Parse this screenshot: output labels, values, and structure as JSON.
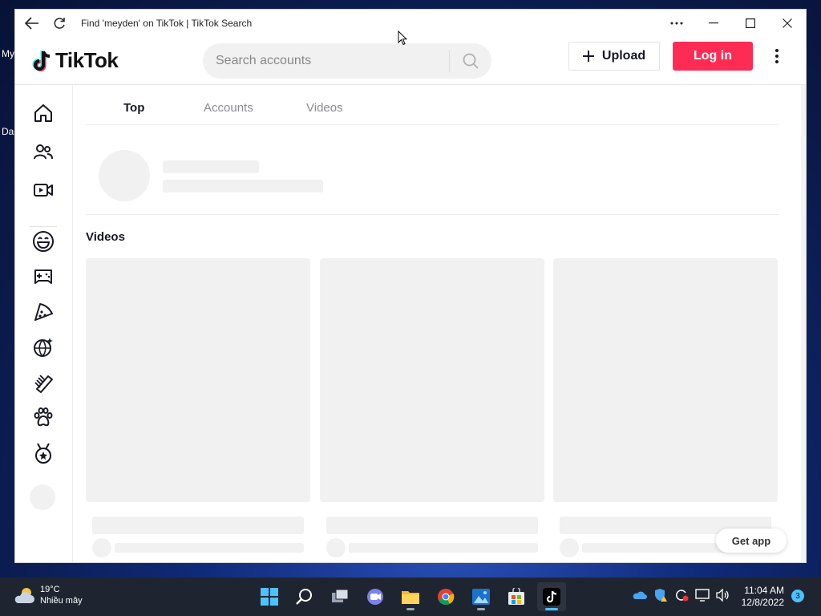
{
  "desktop": {
    "label_1": "My",
    "label_2": "Da"
  },
  "window": {
    "title": "Find 'meyden' on TikTok | TikTok Search"
  },
  "header": {
    "logo_text": "TikTok",
    "search_placeholder": "Search accounts",
    "upload_label": "Upload",
    "login_label": "Log in"
  },
  "tabs": [
    {
      "label": "Top",
      "active": true
    },
    {
      "label": "Accounts",
      "active": false
    },
    {
      "label": "Videos",
      "active": false
    }
  ],
  "main": {
    "videos_section_title": "Videos",
    "get_app_label": "Get app"
  },
  "sidebar": {
    "icons": [
      "home-icon",
      "following-icon",
      "live-icon",
      "comedy-icon",
      "gaming-icon",
      "food-icon",
      "dance-icon",
      "beauty-icon",
      "animals-icon",
      "sports-icon"
    ]
  },
  "taskbar": {
    "weather_temp": "19°C",
    "weather_desc": "Nhiều mây",
    "time": "11:04 AM",
    "date": "12/8/2022",
    "notification_count": "3"
  },
  "colors": {
    "brand_red": "#fe2c55",
    "skeleton": "#f1f1f2",
    "text_primary": "#161823",
    "text_muted": "#8a8b91"
  }
}
